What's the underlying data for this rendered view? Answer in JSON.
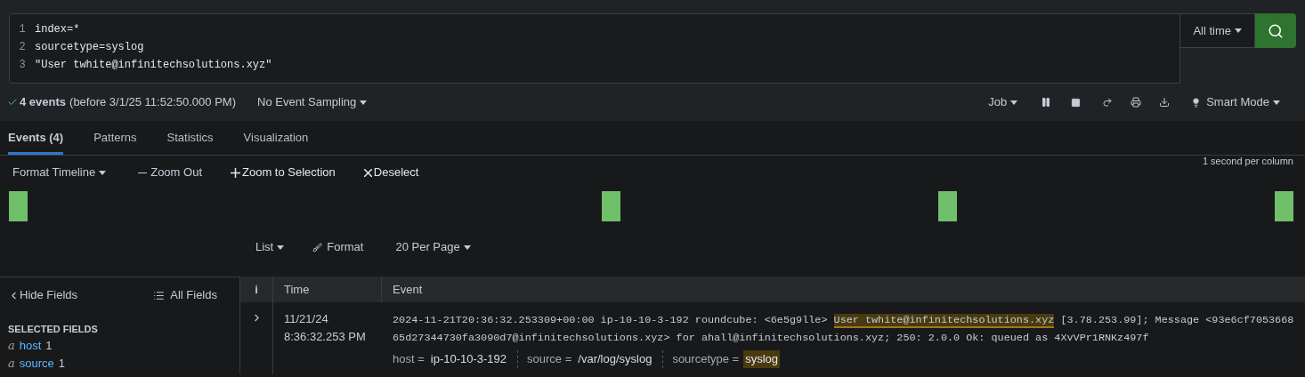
{
  "search": {
    "lines": [
      {
        "number": "1",
        "text": "index=*"
      },
      {
        "number": "2",
        "text": "sourcetype=syslog"
      },
      {
        "number": "3",
        "text": "\"User twhite@infinitechsolutions.xyz\""
      }
    ],
    "time_range": "All time"
  },
  "status": {
    "count": "4 events",
    "detail": "(before 3/1/25 11:52:50.000 PM)",
    "sampling": "No Event Sampling",
    "job": "Job",
    "mode": "Smart Mode"
  },
  "tabs": [
    {
      "label": "Events (4)",
      "selected": true
    },
    {
      "label": "Patterns",
      "selected": false
    },
    {
      "label": "Statistics",
      "selected": false
    },
    {
      "label": "Visualization",
      "selected": false
    }
  ],
  "timeline": {
    "format": "Format Timeline",
    "zoom_out": "Zoom Out",
    "zoom_selection": "Zoom to Selection",
    "deselect": "Deselect",
    "scale": "1 second per column"
  },
  "results_toolbar": {
    "list": "List",
    "format": "Format",
    "per_page": "20 Per Page"
  },
  "fields_sidebar": {
    "hide": "Hide Fields",
    "all": "All Fields",
    "heading": "SELECTED FIELDS",
    "fields": [
      {
        "type": "a",
        "name": "host",
        "count": "1"
      },
      {
        "type": "a",
        "name": "source",
        "count": "1"
      }
    ]
  },
  "table": {
    "columns": [
      "i",
      "Time",
      "Event"
    ],
    "rows": [
      {
        "expanded": false,
        "date": "11/21/24",
        "time": "8:36:32.253 PM",
        "event_before": "2024-11-21T20:36:32.253309+00:00 ip-10-10-3-192 roundcube: <6e5g9lle> ",
        "event_match": "User twhite@infinitechsolutions.xyz",
        "event_after": " [3.78.253.99]; Message <93e6cf705366865d27344730fa3090d7@infinitechsolutions.xyz> for ahall@infinitechsolutions.xyz; 250: 2.0.0 Ok: queued as 4XvVPr1RNKz497f",
        "fields": [
          {
            "key": "host =",
            "value": "ip-10-10-3-192",
            "highlighted": false
          },
          {
            "key": "source =",
            "value": "/var/log/syslog",
            "highlighted": false
          },
          {
            "key": "sourcetype =",
            "value": "syslog",
            "highlighted": true
          }
        ]
      }
    ]
  }
}
